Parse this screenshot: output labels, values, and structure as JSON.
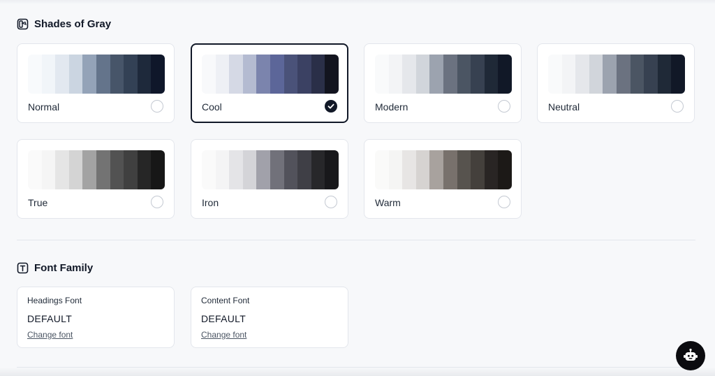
{
  "shades_section": {
    "title": "Shades of Gray",
    "icon": "palette-icon",
    "palettes": [
      {
        "label": "Normal",
        "selected": false,
        "swatches": [
          "#f8fafc",
          "#f1f5f9",
          "#e2e8f0",
          "#cbd5e1",
          "#94a3b8",
          "#64748b",
          "#475569",
          "#334155",
          "#1e293b",
          "#0f172a"
        ]
      },
      {
        "label": "Cool",
        "selected": true,
        "swatches": [
          "#f8f9fb",
          "#eef0f5",
          "#d5d9e5",
          "#b4bbd1",
          "#7b84ad",
          "#5c6699",
          "#4a5279",
          "#3b4163",
          "#2a2f48",
          "#12141f"
        ]
      },
      {
        "label": "Modern",
        "selected": false,
        "swatches": [
          "#f9fafb",
          "#f3f4f6",
          "#e5e7eb",
          "#d1d5db",
          "#9ca3af",
          "#6b7280",
          "#4b5563",
          "#374151",
          "#1f2937",
          "#111827"
        ]
      },
      {
        "label": "Neutral",
        "selected": false,
        "swatches": [
          "#f9fafb",
          "#f3f4f6",
          "#e5e7eb",
          "#d1d5db",
          "#9ca3af",
          "#6b7280",
          "#4b5563",
          "#374151",
          "#1f2937",
          "#111827"
        ]
      },
      {
        "label": "True",
        "selected": false,
        "swatches": [
          "#fafafa",
          "#f5f5f5",
          "#e5e5e5",
          "#d4d4d4",
          "#a3a3a3",
          "#737373",
          "#525252",
          "#404040",
          "#262626",
          "#171717"
        ]
      },
      {
        "label": "Iron",
        "selected": false,
        "swatches": [
          "#fafafa",
          "#f4f4f5",
          "#e4e4e7",
          "#d4d4d8",
          "#a1a1aa",
          "#71717a",
          "#52525b",
          "#3f3f46",
          "#27272a",
          "#18181b"
        ]
      },
      {
        "label": "Warm",
        "selected": false,
        "swatches": [
          "#fafaf9",
          "#f5f5f4",
          "#e7e5e4",
          "#d6d3d1",
          "#a8a29e",
          "#78716c",
          "#57534e",
          "#44403c",
          "#292524",
          "#1c1917"
        ]
      }
    ]
  },
  "font_section": {
    "title": "Font Family",
    "icon": "text-icon",
    "cards": [
      {
        "title": "Headings Font",
        "value": "DEFAULT",
        "link": "Change font"
      },
      {
        "title": "Content Font",
        "value": "DEFAULT",
        "link": "Change font"
      }
    ]
  },
  "assistant": {
    "icon": "robot-icon"
  },
  "colors": {
    "selected_border": "#111827",
    "card_border": "#e3e6ec",
    "background": "#f7f8fa"
  }
}
